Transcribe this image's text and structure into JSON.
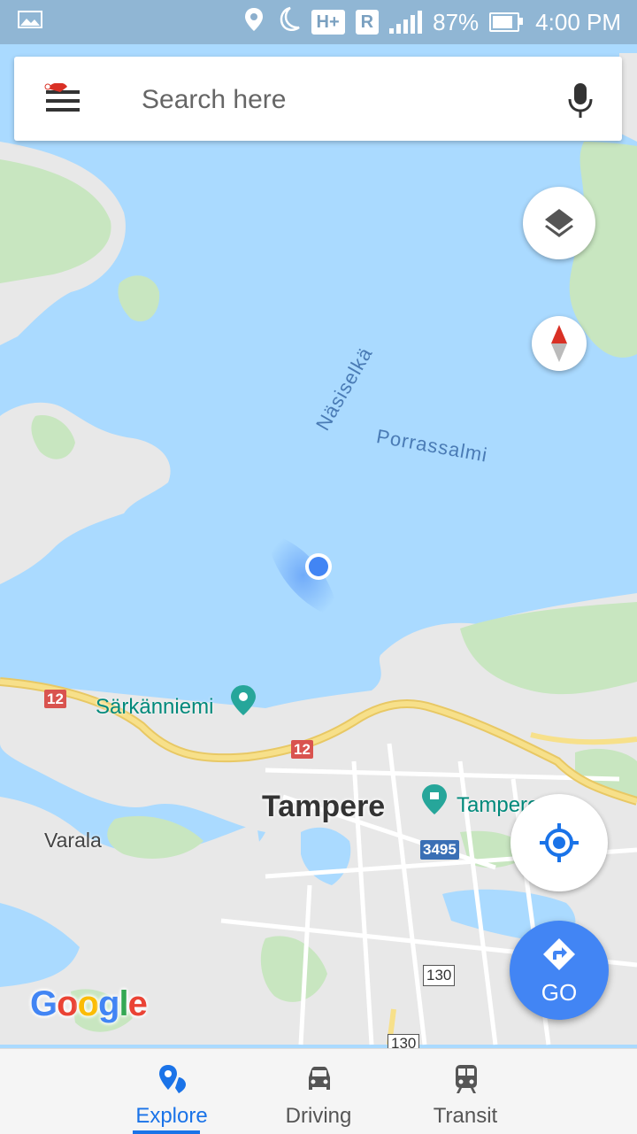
{
  "status_bar": {
    "network": "H+",
    "roaming": "R",
    "battery": "87%",
    "time": "4:00 PM",
    "icons": [
      "gallery-icon",
      "location-icon",
      "moon-icon",
      "signal-icon",
      "battery-icon"
    ]
  },
  "search": {
    "placeholder": "Search here",
    "menu_icon": "hamburger-menu-icon",
    "mic_icon": "microphone-icon"
  },
  "map": {
    "water_labels": [
      "Näsiselkä",
      "Porrassalmi"
    ],
    "place_labels": [
      "Särkänniemi",
      "Tampere",
      "Varala",
      "Tampere"
    ],
    "road_shields": [
      "12",
      "12",
      "3495",
      "130",
      "130"
    ],
    "colors": {
      "water": "#aadaff",
      "land": "#e8e8e8",
      "park": "#c8e6c0",
      "highway": "#f5d76e",
      "location_dot": "#4285f4"
    }
  },
  "controls": {
    "layers_icon": "layers-icon",
    "compass_icon": "compass-icon",
    "my_location_icon": "my-location-icon",
    "go_label": "GO",
    "go_icon": "directions-icon"
  },
  "logo": {
    "letters": [
      "G",
      "o",
      "o",
      "g",
      "l",
      "e"
    ],
    "colors": [
      "#4285f4",
      "#ea4335",
      "#fbbc05",
      "#4285f4",
      "#34a853",
      "#ea4335"
    ]
  },
  "bottom_nav": {
    "items": [
      {
        "label": "Explore",
        "icon": "explore-pin-icon",
        "active": true
      },
      {
        "label": "Driving",
        "icon": "car-icon",
        "active": false
      },
      {
        "label": "Transit",
        "icon": "train-icon",
        "active": false
      }
    ]
  }
}
